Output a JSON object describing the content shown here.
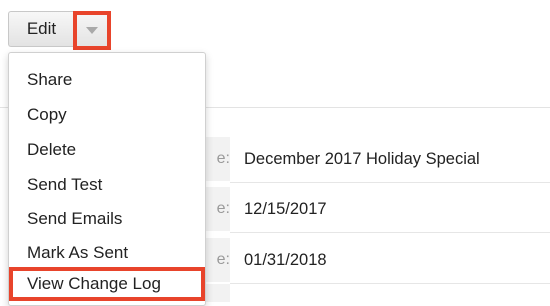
{
  "toolbar": {
    "edit_label": "Edit",
    "dropdown_icon": "caret-down-icon",
    "highlight_color": "#e8442b"
  },
  "menu": {
    "items": [
      {
        "label": "Share"
      },
      {
        "label": "Copy"
      },
      {
        "label": "Delete"
      },
      {
        "label": "Send Test"
      },
      {
        "label": "Send Emails"
      },
      {
        "label": "Mark As Sent"
      },
      {
        "label": "View Change Log",
        "highlighted": true
      }
    ]
  },
  "details": {
    "fields": [
      {
        "label_fragment": "e:",
        "value": "December 2017 Holiday Special"
      },
      {
        "label_fragment": "e:",
        "value": "12/15/2017"
      },
      {
        "label_fragment": "e:",
        "value": "01/31/2018"
      }
    ]
  }
}
